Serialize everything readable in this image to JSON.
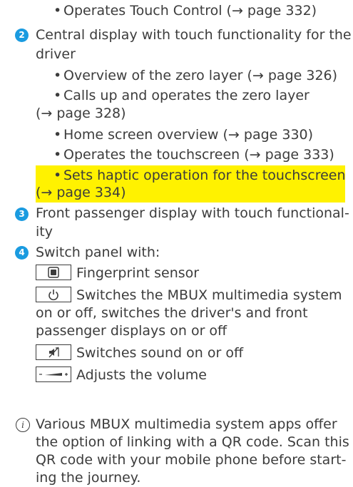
{
  "items": {
    "top_bullet": "Operates Touch Control (→ page 332)",
    "item2": {
      "number": "2",
      "title_line1": "Central display with touch functionality for the",
      "title_line2": "driver",
      "bullets": [
        "Overview of the zero layer (→ page 326)",
        "Calls up and operates the zero layer",
        "(→ page 328)",
        "Home screen overview (→ page 330)",
        "Operates the touchscreen (→ page 333)",
        "Sets haptic operation for the touchscreen",
        "(→ page 334)"
      ]
    },
    "item3": {
      "number": "3",
      "title_line1": "Front passenger display with touch functional-",
      "title_line2": "ity"
    },
    "item4": {
      "number": "4",
      "title": "Switch panel with:",
      "switches": [
        {
          "icon": "fingerprint-sensor-icon",
          "text": "Fingerprint sensor"
        },
        {
          "icon": "power-icon",
          "text": "Switches the MBUX multimedia system"
        },
        {
          "text": "on or off, switches the driver's and front"
        },
        {
          "text": "passenger displays on or off"
        },
        {
          "icon": "mute-icon",
          "text": "Switches sound on or off"
        },
        {
          "icon": "volume-icon",
          "text": "Adjusts the volume"
        }
      ]
    }
  },
  "info": {
    "lines": [
      "Various MBUX multimedia system apps offer",
      "the option of linking with a QR code. Scan this",
      "QR code with your mobile phone before start-",
      "ing the journey."
    ]
  },
  "colors": {
    "highlight": "#fff200",
    "badge": "#1a9be0",
    "text": "#3c3c3c"
  }
}
